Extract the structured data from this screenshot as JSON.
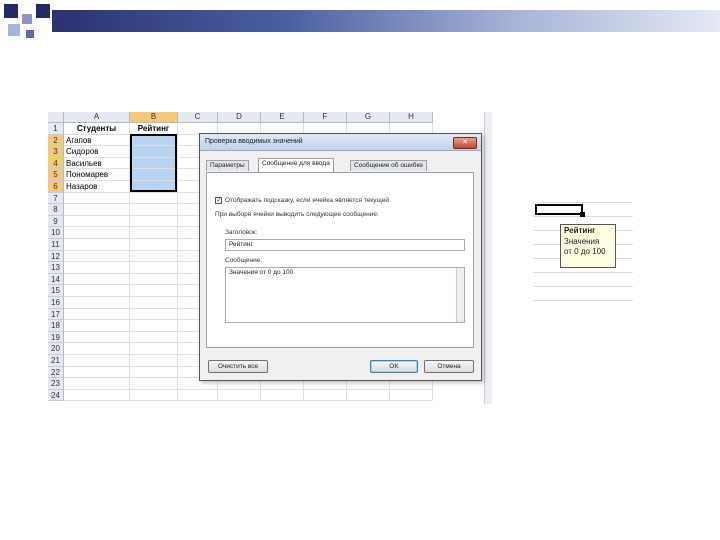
{
  "spreadsheet": {
    "columns": [
      "A",
      "B",
      "C",
      "D",
      "E",
      "F",
      "G",
      "H"
    ],
    "rows": [
      "1",
      "2",
      "3",
      "4",
      "5",
      "6",
      "7",
      "8",
      "9",
      "10",
      "11",
      "12",
      "13",
      "14",
      "15",
      "16",
      "17",
      "18",
      "19",
      "20",
      "21",
      "22",
      "23",
      "24"
    ],
    "header_students": "Студенты",
    "header_rating": "Рейтинг",
    "students": [
      "Агапов",
      "Сидоров",
      "Васильев",
      "Пономарев",
      "Назаров"
    ]
  },
  "dialog": {
    "title": "Проверка вводимых значений",
    "close": "✕",
    "tabs": [
      "Параметры",
      "Сообщение для ввода",
      "Сообщение об ошибке"
    ],
    "active_tab": 1,
    "show_tip_checkbox": "Отображать подсказку, если ячейка является текущей",
    "when_selected_label": "При выборе ячейки выводить следующее сообщение:",
    "title_label": "Заголовок:",
    "title_value": "Рейтинг",
    "message_label": "Сообщение:",
    "message_value": "Значения от 0 до 100",
    "clear_all_button": "Очистить все",
    "ok_button": "OK",
    "cancel_button": "Отмена"
  },
  "tooltip": {
    "title": "Рейтинг",
    "line1": "Значения",
    "line2": "от 0 до 100"
  }
}
